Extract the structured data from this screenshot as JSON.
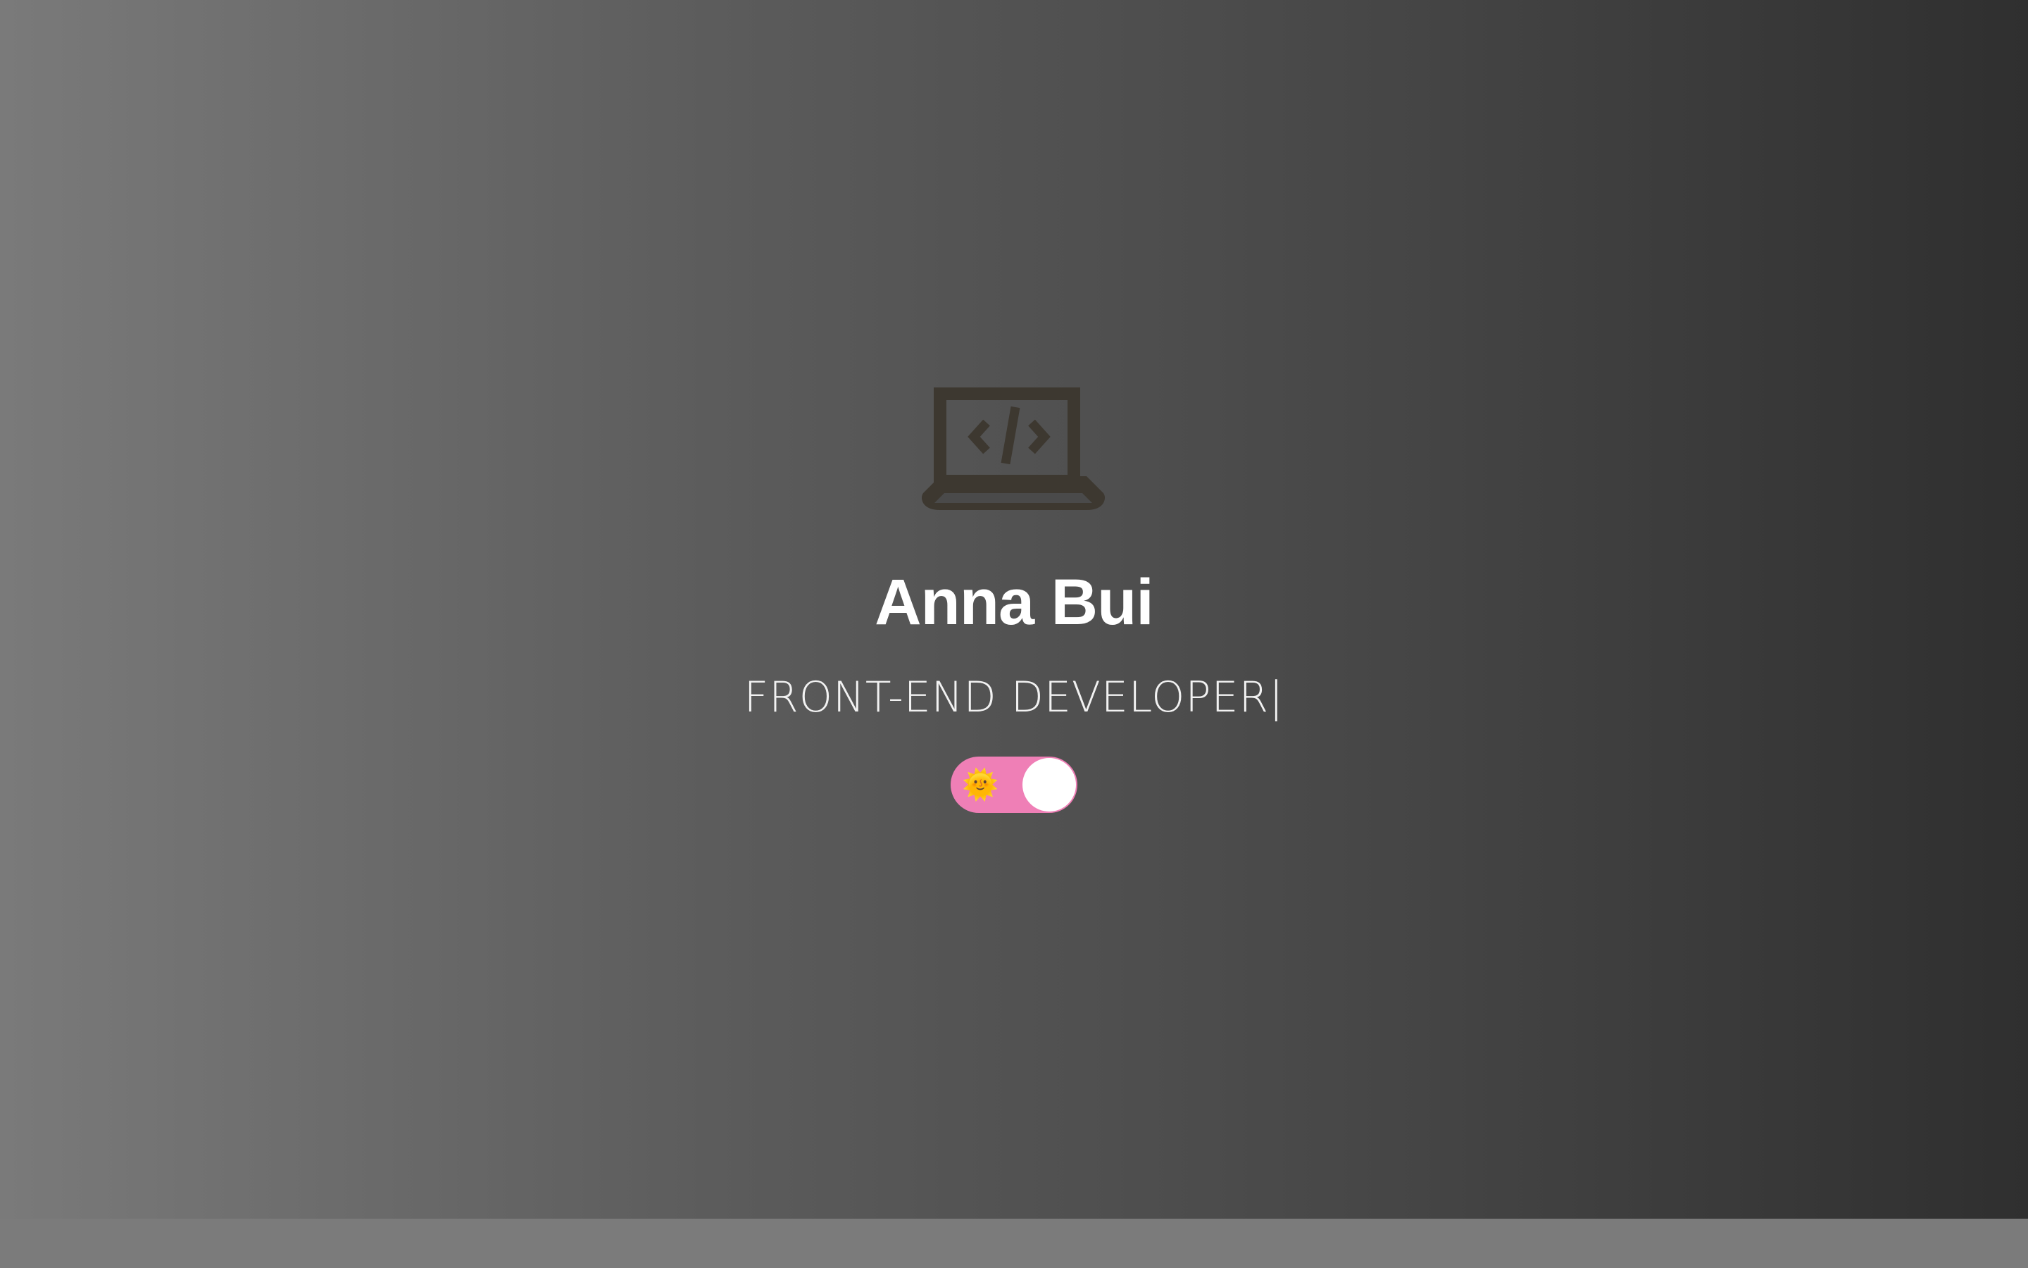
{
  "profile": {
    "name": "Anna Bui",
    "role": "FRONT-END DEVELOPER",
    "cursor": "|"
  },
  "icons": {
    "hero_icon": "laptop-code-icon",
    "theme_icon": "sun-icon"
  },
  "theme_toggle": {
    "icon_glyph": "🌞",
    "state": "light"
  },
  "colors": {
    "gradient_start": "#7a7a7a",
    "gradient_end": "#2f2f2f",
    "icon_color": "#3d3830",
    "toggle_track": "#ef7fb6",
    "toggle_knob": "#ffffff",
    "text": "#ffffff"
  }
}
